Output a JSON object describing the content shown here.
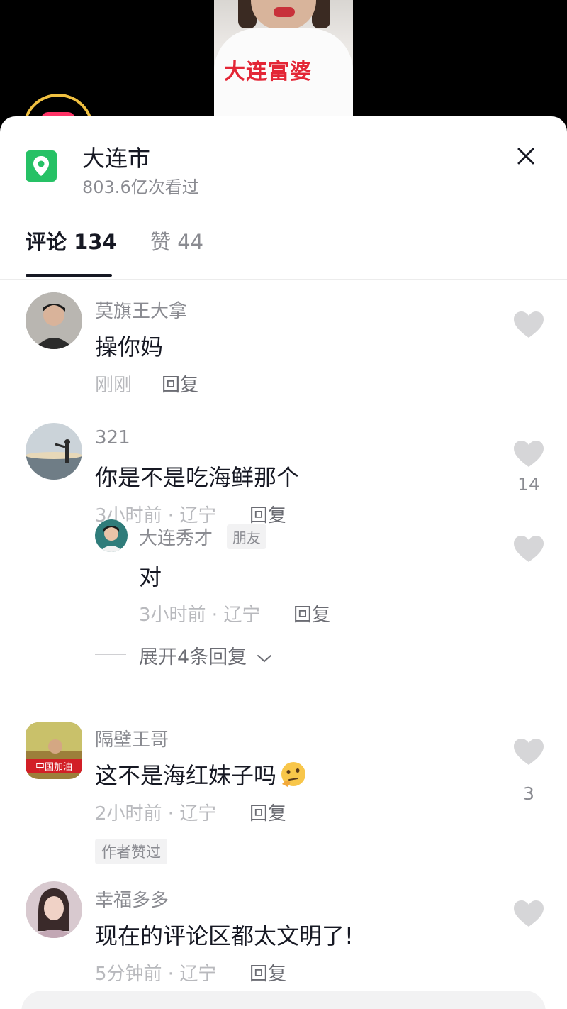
{
  "video": {
    "caption": "大连富婆"
  },
  "location": {
    "title": "大连市",
    "views": "803.6亿次看过",
    "icon": "location-pin-icon",
    "accent": "#26c165"
  },
  "tabs": [
    {
      "label": "评论 134",
      "active": true
    },
    {
      "label": "赞 44",
      "active": false
    }
  ],
  "comments": [
    {
      "name": "莫旗王大拿",
      "text": "操你妈",
      "time": "刚刚",
      "reply_label": "回复",
      "likes": ""
    },
    {
      "name": "321",
      "text": "你是不是吃海鲜那个",
      "time": "3小时前 · 辽宁",
      "reply_label": "回复",
      "likes": "14",
      "replies": [
        {
          "name": "大连秀才",
          "badge": "朋友",
          "text": "对",
          "time": "3小时前 · 辽宁",
          "reply_label": "回复"
        }
      ],
      "expand_label": "展开4条回复"
    },
    {
      "name": "隔壁王哥",
      "text": "这不是海红妹子吗",
      "emoji": "thinking-emoji",
      "time": "2小时前 · 辽宁",
      "reply_label": "回复",
      "likes": "3",
      "badge": "作者赞过",
      "avatar_text": "中国加油"
    },
    {
      "name": "幸福多多",
      "text": "现在的评论区都太文明了!",
      "time": "5分钟前 · 辽宁",
      "reply_label": "回复",
      "likes": ""
    }
  ]
}
